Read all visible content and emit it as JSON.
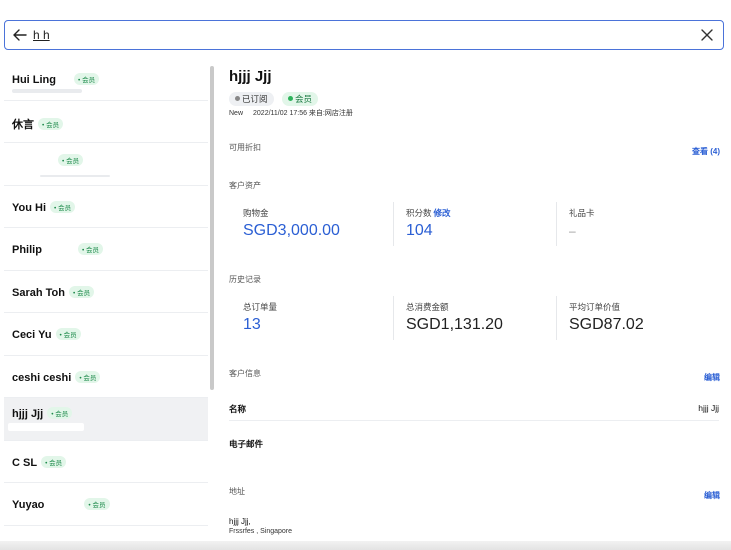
{
  "search": {
    "value": "h h",
    "placeholder": ""
  },
  "sidebar": {
    "items": [
      {
        "name": "Hui Ling",
        "badge": "会员"
      },
      {
        "name": "休言",
        "badge": "会员"
      },
      {
        "name": "",
        "badge": "会员"
      },
      {
        "name": "You Hi",
        "badge": "会员"
      },
      {
        "name": "Philip",
        "badge": "会员"
      },
      {
        "name": "Sarah Toh",
        "badge": "会员"
      },
      {
        "name": "Ceci Yu",
        "badge": "会员"
      },
      {
        "name": "ceshi ceshi",
        "badge": "会员"
      },
      {
        "name": "hjjj Jjj",
        "badge": "会员"
      },
      {
        "name": "C SL",
        "badge": "会员"
      },
      {
        "name": "Yuyao",
        "badge": "会员"
      }
    ]
  },
  "detail": {
    "name": "hjjj Jjj",
    "status_subscribed": "已订阅",
    "status_member": "会员",
    "meta_new": "New",
    "meta_date": "2022/11/02 17:56 来自:网店注册",
    "discounts_label": "可用折扣",
    "discounts_view": "查看 (4)",
    "assets_label": "客户资产",
    "assets": {
      "cash_label": "购物金",
      "cash_value": "SGD3,000.00",
      "points_label": "积分数",
      "points_edit": "修改",
      "points_value": "104",
      "gift_label": "礼品卡",
      "gift_value": "–"
    },
    "history_label": "历史记录",
    "history": {
      "orders_label": "总订单量",
      "orders_value": "13",
      "spent_label": "总消费金额",
      "spent_value": "SGD1,131.20",
      "avg_label": "平均订单价值",
      "avg_value": "SGD87.02"
    },
    "info_label": "客户信息",
    "info_edit": "编辑",
    "name_key": "名称",
    "name_value": "hjjj Jjj",
    "email_key": "电子邮件",
    "address_label": "地址",
    "address_edit": "编辑",
    "address_line1": "hjjj Jjj,",
    "address_line2": "Frssrfes                    , Singapore"
  },
  "colors": {
    "accent": "#2b5fd4",
    "member_green": "#1a7a42",
    "member_bg": "#e2f6e9",
    "border_focus": "#4b73d9"
  },
  "icons": {
    "back": "arrow-left-icon",
    "close": "close-icon"
  }
}
